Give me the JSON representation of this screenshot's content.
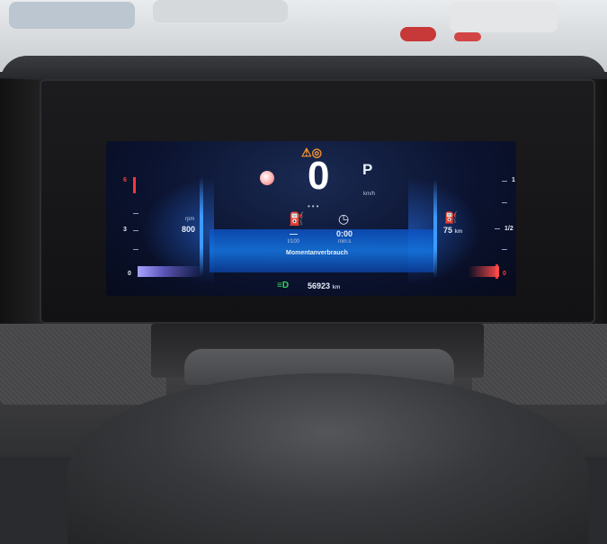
{
  "cluster": {
    "speed": "0",
    "speed_unit": "km/h",
    "gear": "P",
    "rpm_label": "rpm",
    "rpm_value": "800",
    "tach_scale_top": "6",
    "tach_scale_mid": "3",
    "tach_scale_bottom": "0",
    "fuel_scale_top": "1",
    "fuel_scale_mid": "1/2",
    "fuel_scale_bottom": "0",
    "range_value": "75",
    "range_unit": "km",
    "consumption_value": "—",
    "consumption_unit": "l/100",
    "time_value": "0:00",
    "time_unit": "min:s",
    "consumption_title": "Momentanverbrauch",
    "odometer_value": "56923",
    "odometer_unit": "km"
  },
  "icons": {
    "warning": "seatbelt-warning-icon",
    "fuel_consumption": "fuel-gauge-icon",
    "timer": "stopwatch-icon",
    "headlight": "low-beam-headlight-icon",
    "fuel_pump": "fuel-pump-icon",
    "status_dot": "status-light-icon"
  },
  "colors": {
    "accent_blue": "#1478e6",
    "warning_orange": "#ff9a2e",
    "alert_red": "#ff3b3b",
    "headlight_green": "#35d35a"
  }
}
